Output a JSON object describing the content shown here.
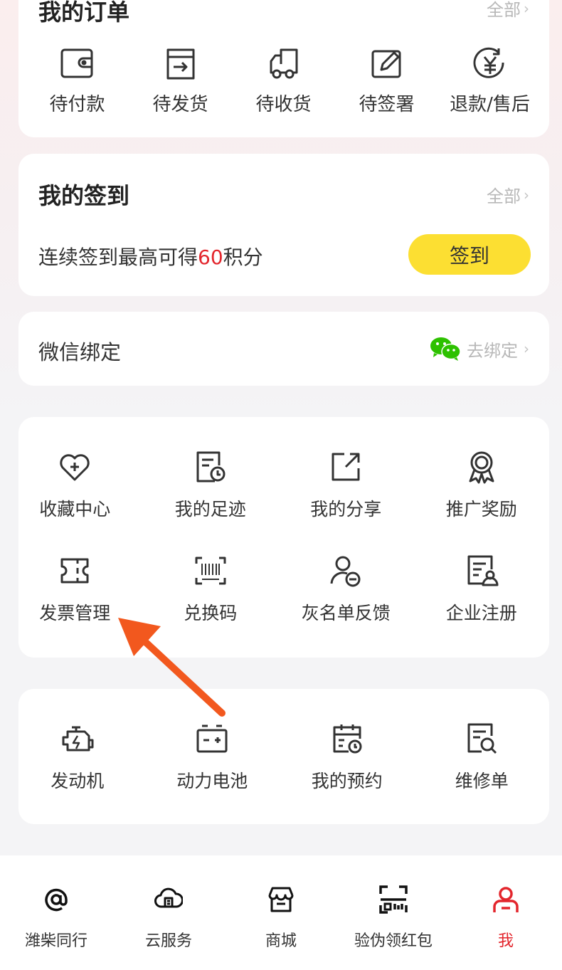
{
  "orders": {
    "title": "我的订单",
    "more": "全部",
    "items": [
      {
        "label": "待付款",
        "icon": "wallet-icon"
      },
      {
        "label": "待发货",
        "icon": "box-out-icon"
      },
      {
        "label": "待收货",
        "icon": "truck-icon"
      },
      {
        "label": "待签署",
        "icon": "sign-edit-icon"
      },
      {
        "label": "退款/售后",
        "icon": "refund-icon"
      }
    ]
  },
  "signin": {
    "title": "我的签到",
    "more": "全部",
    "desc_prefix": "连续签到最高可得",
    "desc_points": "60",
    "desc_suffix": "积分",
    "button": "签到",
    "button_color": "#fcdf32",
    "points_color": "#e3262d"
  },
  "wechat": {
    "label": "微信绑定",
    "action": "去绑定",
    "icon": "wechat-icon"
  },
  "services": {
    "row1": [
      {
        "label": "收藏中心",
        "icon": "heart-plus-icon"
      },
      {
        "label": "我的足迹",
        "icon": "history-icon"
      },
      {
        "label": "我的分享",
        "icon": "share-icon"
      },
      {
        "label": "推广奖励",
        "icon": "award-icon"
      }
    ],
    "row2": [
      {
        "label": "发票管理",
        "icon": "invoice-icon"
      },
      {
        "label": "兑换码",
        "icon": "barcode-icon"
      },
      {
        "label": "灰名单反馈",
        "icon": "user-minus-icon"
      },
      {
        "label": "企业注册",
        "icon": "enterprise-icon"
      }
    ]
  },
  "tools": [
    {
      "label": "发动机",
      "icon": "engine-icon"
    },
    {
      "label": "动力电池",
      "icon": "battery-icon"
    },
    {
      "label": "我的预约",
      "icon": "calendar-icon"
    },
    {
      "label": "维修单",
      "icon": "repair-order-icon"
    }
  ],
  "nav": [
    {
      "label": "潍柴同行",
      "icon": "at-icon"
    },
    {
      "label": "云服务",
      "icon": "cloud-icon"
    },
    {
      "label": "商城",
      "icon": "store-icon"
    },
    {
      "label": "验伪领红包",
      "icon": "scan-icon"
    },
    {
      "label": "我",
      "icon": "user-icon",
      "active": true
    }
  ],
  "accent_color": "#e3262d",
  "annotation_arrow_color": "#f2581e"
}
